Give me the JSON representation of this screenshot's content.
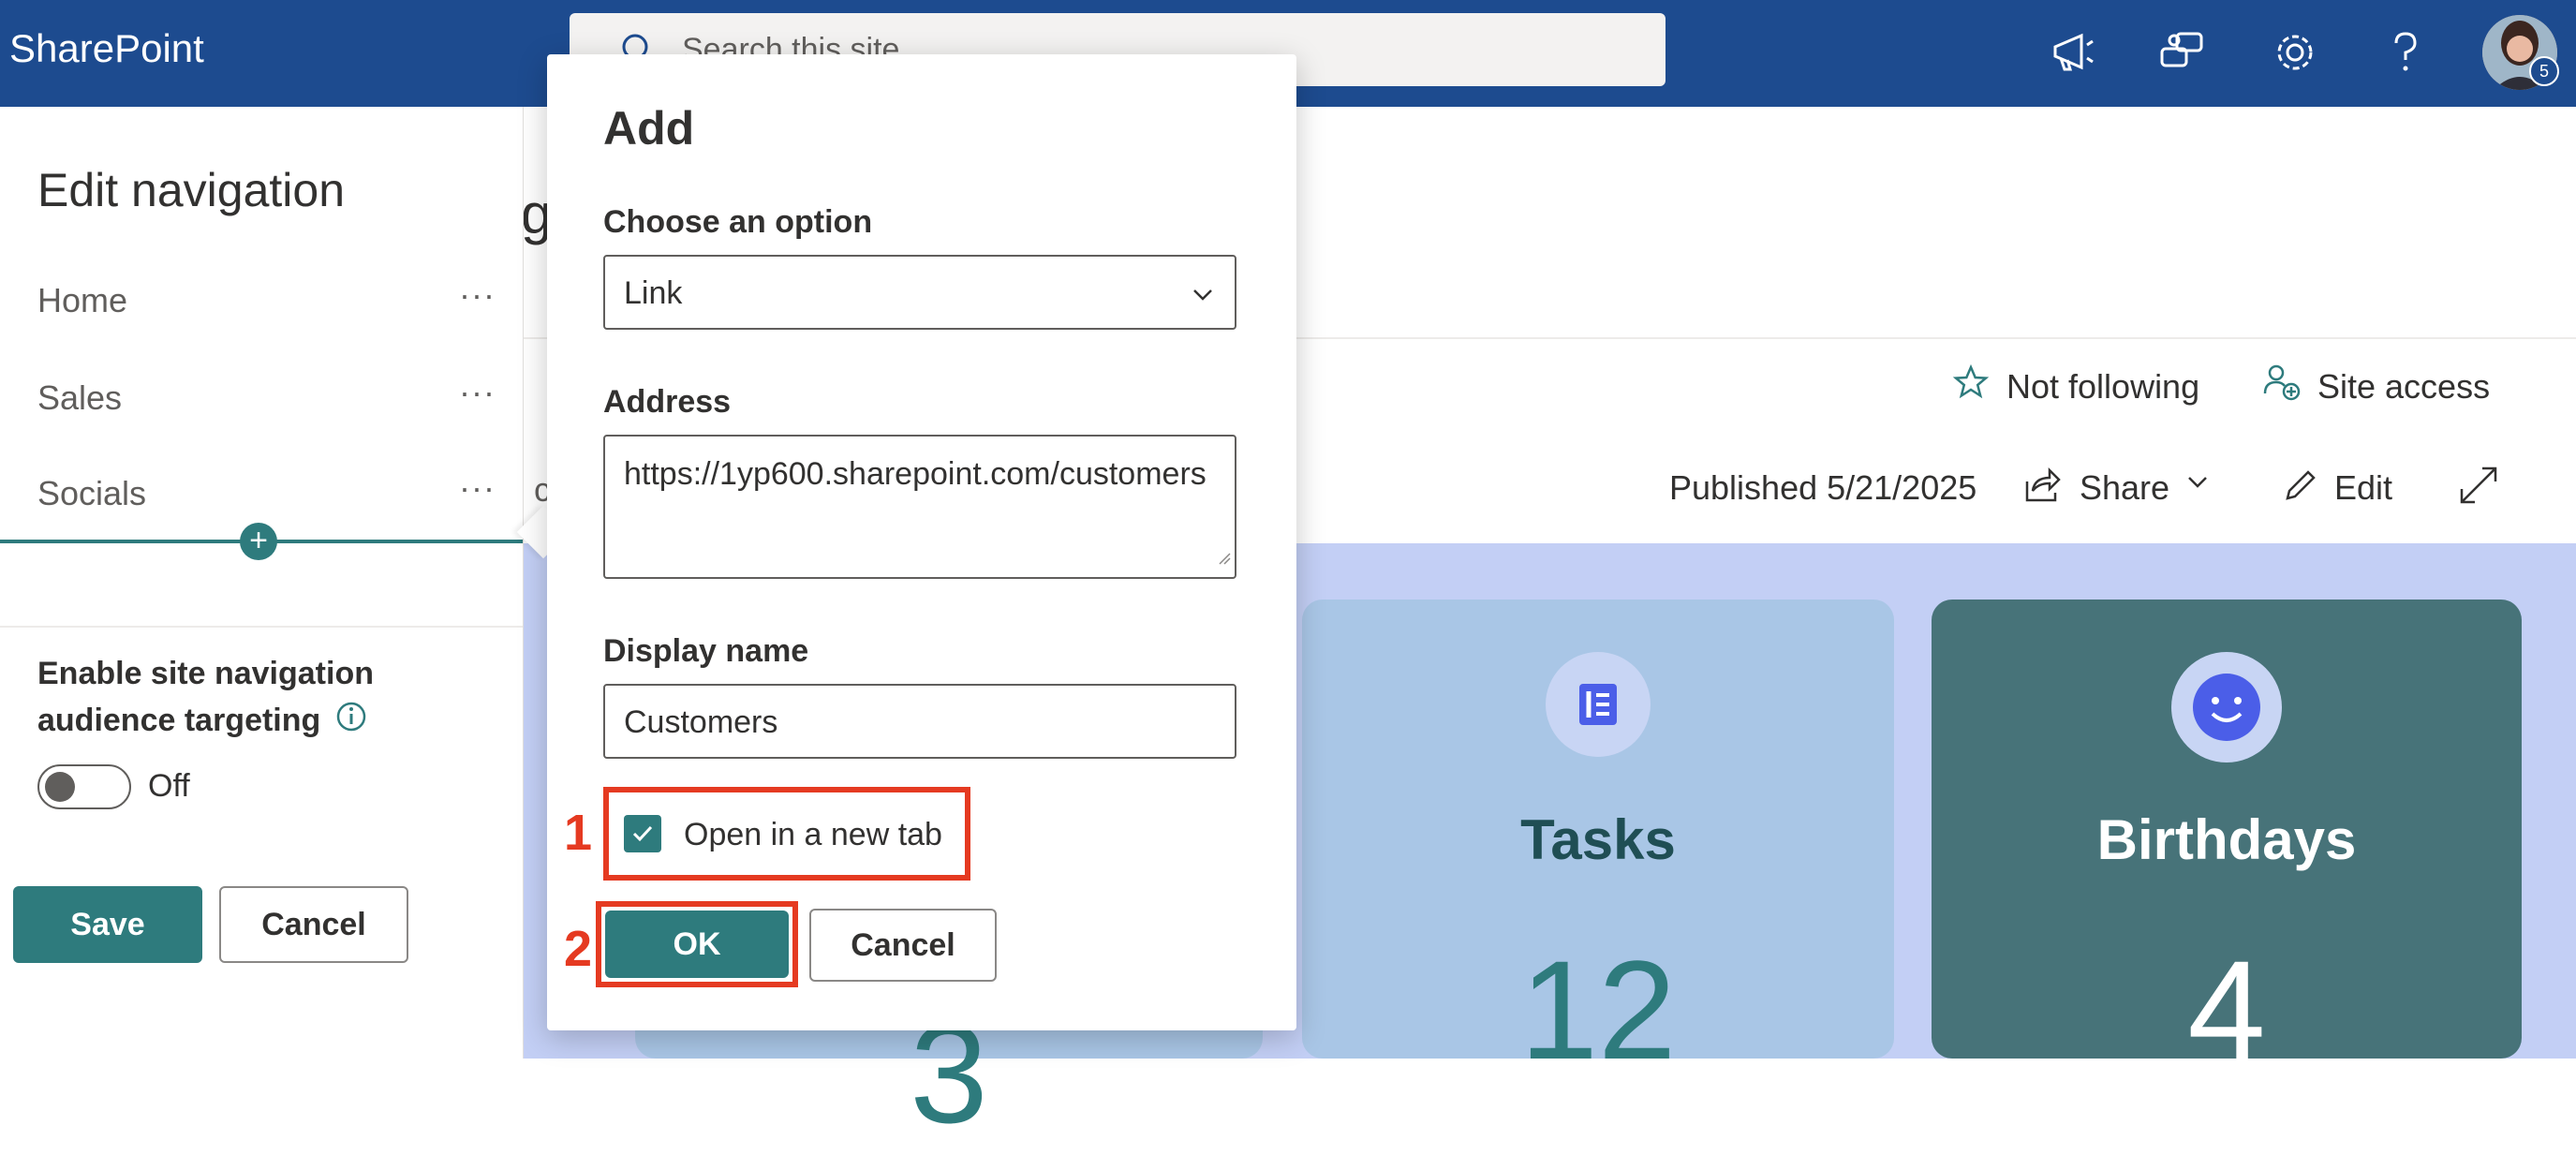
{
  "topbar": {
    "brand": "SharePoint",
    "search_placeholder": "Search this site",
    "icons": [
      "megaphone-icon",
      "chat-icon",
      "gear-icon",
      "help-icon"
    ],
    "avatar_badge": "5",
    "color": "#1d4b8f"
  },
  "left_panel": {
    "title": "Edit navigation",
    "nav_items": [
      {
        "label": "Home",
        "more": "···"
      },
      {
        "label": "Sales",
        "more": "···"
      },
      {
        "label": "Socials",
        "more": "···"
      }
    ],
    "add_symbol": "+",
    "targeting_label": "Enable site navigation audience targeting",
    "toggle_label": "Off",
    "save_label": "Save",
    "cancel_label": "Cancel"
  },
  "page": {
    "heading_fragment": "g",
    "side_fragment": "c",
    "not_following": "Not following",
    "site_access": "Site access",
    "published": "Published 5/21/2025",
    "share": "Share",
    "edit": "Edit",
    "cards": [
      {
        "title": "Tasks",
        "count": "12",
        "icon": "list-icon"
      },
      {
        "title": "Birthdays",
        "count": "4",
        "icon": "smiley-icon"
      }
    ],
    "partial_number": "3"
  },
  "dialog": {
    "title": "Add",
    "choose_label": "Choose an option",
    "choose_value": "Link",
    "address_label": "Address",
    "address_value": "https://1yp600.sharepoint.com/customers",
    "display_name_label": "Display name",
    "display_name_value": "Customers",
    "open_new_tab_label": "Open in a new tab",
    "open_new_tab_checked": true,
    "ok_label": "OK",
    "cancel_label": "Cancel",
    "step_1": "1",
    "step_2": "2",
    "highlight_color": "#e53a21"
  }
}
